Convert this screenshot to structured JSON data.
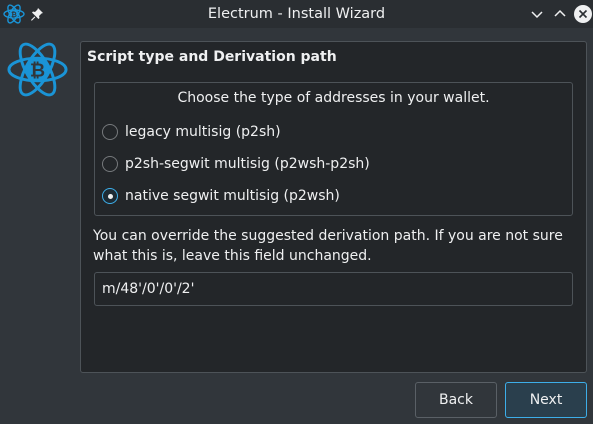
{
  "window": {
    "title": "Electrum - Install Wizard",
    "icon": "electrum-logo-icon",
    "pin_icon": "pin-icon",
    "controls": [
      "minimize-icon",
      "maximize-icon",
      "close-icon"
    ]
  },
  "page": {
    "heading": "Script type and Derivation path",
    "logo": "electrum-logo-icon"
  },
  "address_type": {
    "prompt": "Choose the type of addresses in your wallet.",
    "options": [
      {
        "label": "legacy multisig (p2sh)",
        "checked": false
      },
      {
        "label": "p2sh-segwit multisig (p2wsh-p2sh)",
        "checked": false
      },
      {
        "label": "native segwit multisig (p2wsh)",
        "checked": true
      }
    ]
  },
  "derivation": {
    "help": "You can override the suggested derivation path. If you are not sure what this is, leave this field unchanged.",
    "value": "m/48'/0'/0'/2'"
  },
  "buttons": {
    "back": "Back",
    "next": "Next"
  },
  "colors": {
    "accent": "#3daee9",
    "window_bg": "#31363b",
    "panel_bg": "#232629",
    "logo": "#1a94d6"
  }
}
